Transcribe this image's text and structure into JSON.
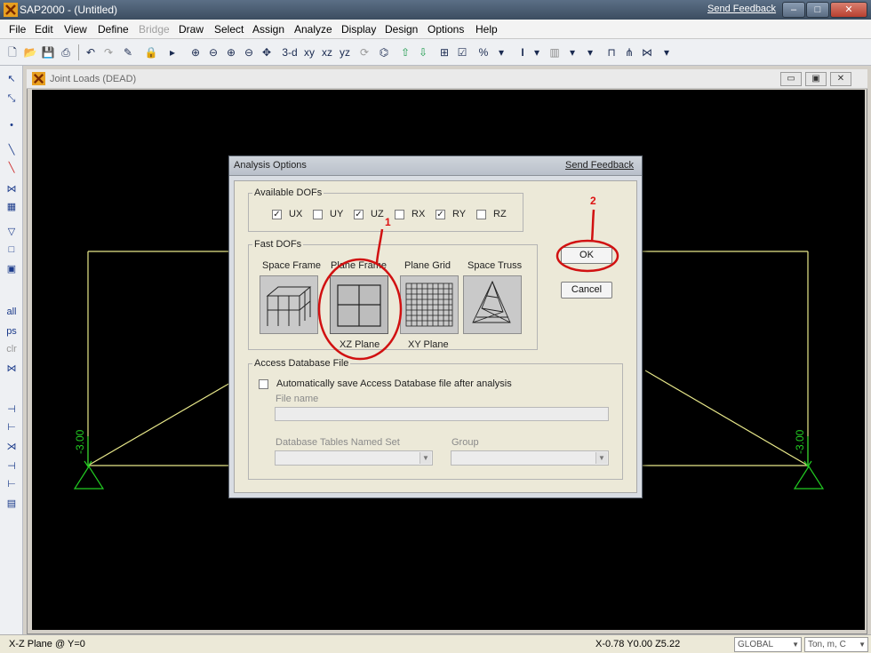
{
  "app": {
    "title": "SAP2000 - (Untitled)",
    "send_feedback": "Send Feedback"
  },
  "menu": [
    {
      "label": "File",
      "disabled": false
    },
    {
      "label": "Edit",
      "disabled": false
    },
    {
      "label": "View",
      "disabled": false
    },
    {
      "label": "Define",
      "disabled": false
    },
    {
      "label": "Bridge",
      "disabled": true
    },
    {
      "label": "Draw",
      "disabled": false
    },
    {
      "label": "Select",
      "disabled": false
    },
    {
      "label": "Assign",
      "disabled": false
    },
    {
      "label": "Analyze",
      "disabled": false
    },
    {
      "label": "Display",
      "disabled": false
    },
    {
      "label": "Design",
      "disabled": false
    },
    {
      "label": "Options",
      "disabled": false
    },
    {
      "label": "Help",
      "disabled": false
    }
  ],
  "toolbar": {
    "view_labels": [
      "3-d",
      "xy",
      "xz",
      "yz"
    ]
  },
  "mdi": {
    "title": "Joint Loads (DEAD)",
    "load_label_left": "-3.00",
    "load_label_right": "-3.00"
  },
  "dialog": {
    "title": "Analysis Options",
    "send_feedback": "Send Feedback",
    "available_dofs": {
      "legend": "Available DOFs",
      "items": [
        {
          "label": "UX",
          "checked": true
        },
        {
          "label": "UY",
          "checked": false
        },
        {
          "label": "UZ",
          "checked": true
        },
        {
          "label": "RX",
          "checked": false
        },
        {
          "label": "RY",
          "checked": true
        },
        {
          "label": "RZ",
          "checked": false
        }
      ]
    },
    "fast_dofs": {
      "legend": "Fast DOFs",
      "options": [
        {
          "label": "Space Frame",
          "sublabel": "",
          "icon": "space-frame-icon"
        },
        {
          "label": "Plane Frame",
          "sublabel": "XZ Plane",
          "icon": "plane-frame-icon",
          "selected": true
        },
        {
          "label": "Plane Grid",
          "sublabel": "XY Plane",
          "icon": "plane-grid-icon"
        },
        {
          "label": "Space Truss",
          "sublabel": "",
          "icon": "space-truss-icon"
        }
      ]
    },
    "access_db": {
      "legend": "Access Database File",
      "auto_save_label": "Automatically save Access Database file after analysis",
      "auto_save_checked": false,
      "file_name_label": "File name",
      "file_name_value": "",
      "named_set_label": "Database Tables Named Set",
      "named_set_value": "",
      "group_label": "Group",
      "group_value": ""
    },
    "ok_label": "OK",
    "cancel_label": "Cancel"
  },
  "annotations": {
    "marker_1": "1",
    "marker_2": "2",
    "color": "#d11111"
  },
  "statusbar": {
    "plane": "X-Z Plane @ Y=0",
    "coords": "X-0.78  Y0.00  Z5.22",
    "coord_system": "GLOBAL",
    "units": "Ton, m, C"
  },
  "colors": {
    "structure": "#e8e88a",
    "support": "#22cc22",
    "canvas": "#000000"
  }
}
